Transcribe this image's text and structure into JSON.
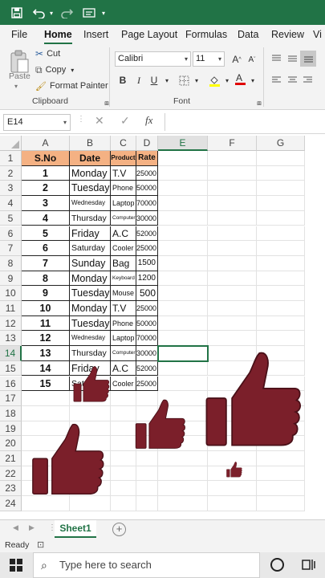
{
  "titlebar": {
    "save_icon": "save-icon",
    "undo_icon": "undo-icon",
    "redo_icon": "redo-icon",
    "qat_icon": "form-icon"
  },
  "tabs": [
    "File",
    "Home",
    "Insert",
    "Page Layout",
    "Formulas",
    "Data",
    "Review",
    "Vi"
  ],
  "active_tab": "Home",
  "clipboard": {
    "paste_label": "Paste",
    "cut_label": "Cut",
    "copy_label": "Copy",
    "format_painter_label": "Format Painter",
    "group_label": "Clipboard"
  },
  "font": {
    "font_name": "Calibri",
    "font_size": "11",
    "bold": "B",
    "italic": "I",
    "underline": "U",
    "grow": "A",
    "shrink": "A",
    "group_label": "Font"
  },
  "formula_bar": {
    "name_box": "E14",
    "fx_label": "fx",
    "formula": ""
  },
  "columns": [
    "A",
    "B",
    "C",
    "D",
    "E",
    "F",
    "G"
  ],
  "selected_column": "E",
  "selected_row": "14",
  "rows": [
    "1",
    "2",
    "3",
    "4",
    "5",
    "6",
    "7",
    "8",
    "9",
    "10",
    "11",
    "12",
    "13",
    "14",
    "15",
    "16",
    "17",
    "18",
    "19",
    "20",
    "21",
    "22",
    "23",
    "24"
  ],
  "table": {
    "headers": [
      "S.No",
      "Date",
      "Product",
      "Rate"
    ],
    "records": [
      {
        "sno": "1",
        "day": "Monday",
        "product": "T.V",
        "rate": "25000"
      },
      {
        "sno": "2",
        "day": "Tuesday",
        "product": "Phone",
        "rate": "50000"
      },
      {
        "sno": "3",
        "day": "Wednesday",
        "product": "Laptop",
        "rate": "70000"
      },
      {
        "sno": "4",
        "day": "Thursday",
        "product": "Computer",
        "rate": "30000"
      },
      {
        "sno": "5",
        "day": "Friday",
        "product": "A.C",
        "rate": "52000"
      },
      {
        "sno": "6",
        "day": "Saturday",
        "product": "Cooler",
        "rate": "25000"
      },
      {
        "sno": "7",
        "day": "Sunday",
        "product": "Bag",
        "rate": "1500"
      },
      {
        "sno": "8",
        "day": "Monday",
        "product": "Keyboard",
        "rate": "1200"
      },
      {
        "sno": "9",
        "day": "Tuesday",
        "product": "Mouse",
        "rate": "500"
      },
      {
        "sno": "10",
        "day": "Monday",
        "product": "T.V",
        "rate": "25000"
      },
      {
        "sno": "11",
        "day": "Tuesday",
        "product": "Phone",
        "rate": "50000"
      },
      {
        "sno": "12",
        "day": "Wednesday",
        "product": "Laptop",
        "rate": "70000"
      },
      {
        "sno": "13",
        "day": "Thursday",
        "product": "Computer",
        "rate": "30000"
      },
      {
        "sno": "14",
        "day": "Friday",
        "product": "A.C",
        "rate": "52000"
      },
      {
        "sno": "15",
        "day": "Saturday",
        "product": "Cooler",
        "rate": "25000"
      }
    ]
  },
  "sheet": {
    "name": "Sheet1",
    "add_icon": "plus-icon"
  },
  "status": {
    "text": "Ready"
  },
  "taskbar": {
    "search_placeholder": "Type here to search",
    "start_icon": "windows-icon"
  },
  "colors": {
    "excel_green": "#217346",
    "header_fill": "#f4b183",
    "thumb": "#7b1f2a"
  }
}
